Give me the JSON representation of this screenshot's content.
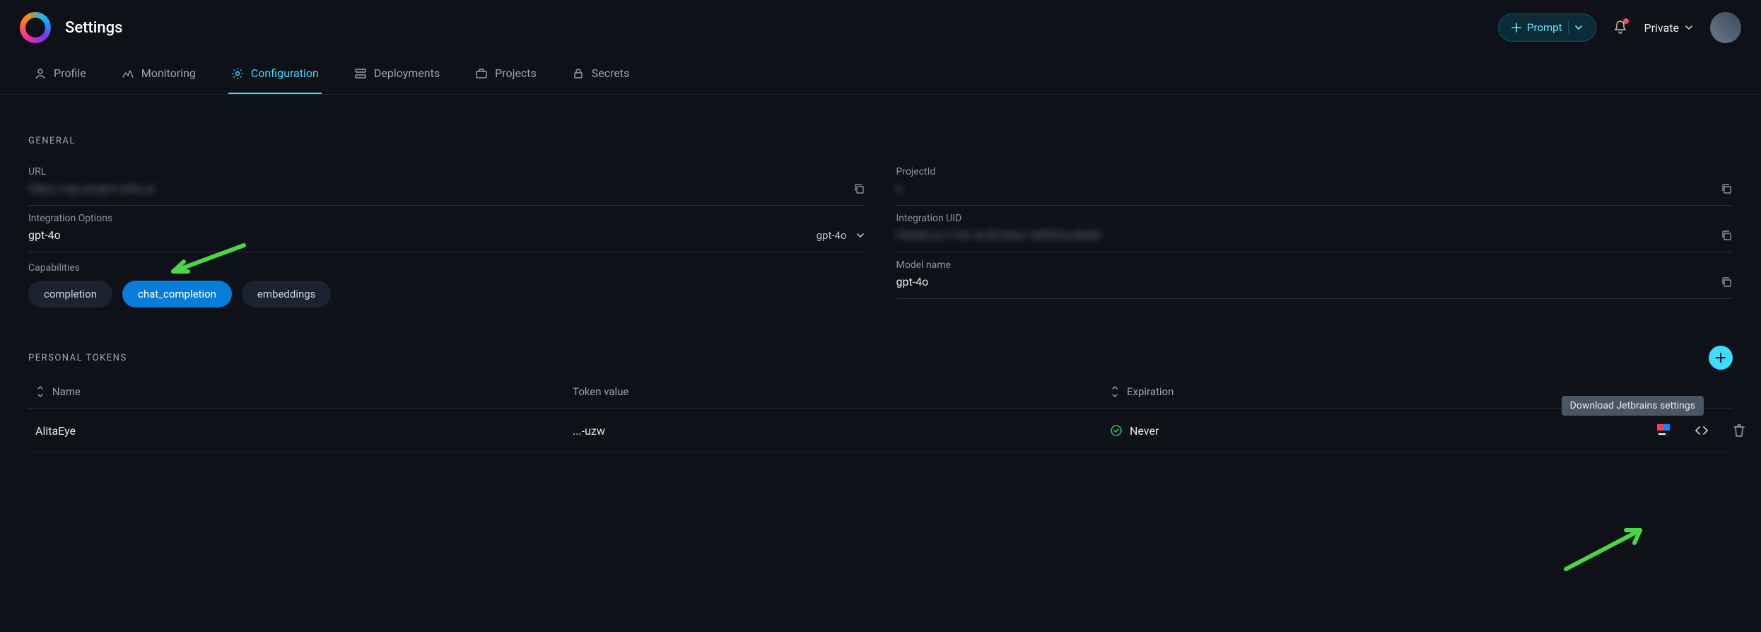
{
  "header": {
    "page_title": "Settings",
    "prompt_label": "Prompt",
    "scope_label": "Private"
  },
  "tabs": [
    {
      "label": "Profile"
    },
    {
      "label": "Monitoring"
    },
    {
      "label": "Configuration"
    },
    {
      "label": "Deployments"
    },
    {
      "label": "Projects"
    },
    {
      "label": "Secrets"
    }
  ],
  "sections": {
    "general": "GENERAL",
    "tokens": "PERSONAL TOKENS"
  },
  "general": {
    "url": {
      "label": "URL",
      "value": "https://api.project.alita.ai"
    },
    "project_id": {
      "label": "ProjectId",
      "value": "6"
    },
    "integration_options": {
      "label": "Integration Options",
      "value": "gpt-4o",
      "selected": "gpt-4o"
    },
    "integration_uid": {
      "label": "Integration UID",
      "value": "f5668cca-7c9c-4c59-86a7-98ff62ca868b"
    },
    "capabilities": {
      "label": "Capabilities",
      "items": [
        "completion",
        "chat_completion",
        "embeddings"
      ],
      "active": "chat_completion"
    },
    "model_name": {
      "label": "Model name",
      "value": "gpt-4o"
    }
  },
  "tokens_table": {
    "headers": {
      "name": "Name",
      "token_value": "Token value",
      "expiration": "Expiration"
    },
    "rows": [
      {
        "name": "AlitaEye",
        "token_value": "...-uzw",
        "expiration": "Never"
      }
    ]
  },
  "tooltip": "Download Jetbrains settings"
}
